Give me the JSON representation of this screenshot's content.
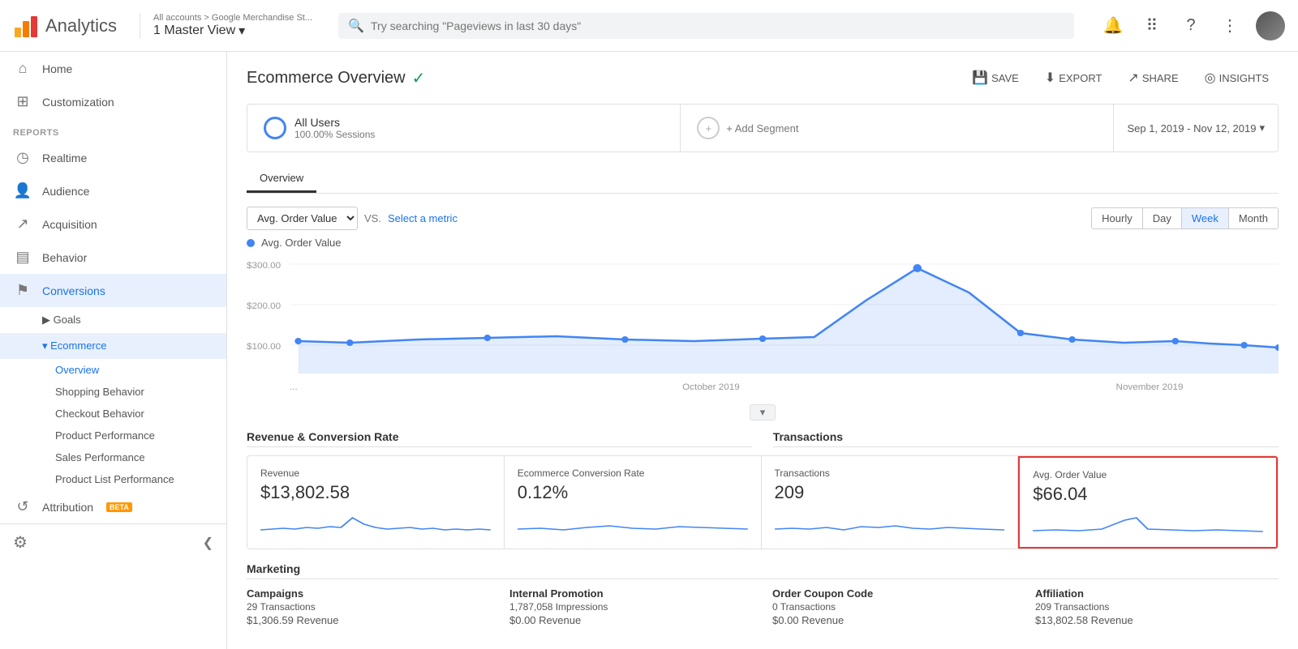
{
  "topbar": {
    "logo_text": "Analytics",
    "account_path": "All accounts > Google Merchandise St...",
    "account_view": "1 Master View",
    "search_placeholder": "Try searching \"Pageviews in last 30 days\"",
    "chevron": "▾"
  },
  "sidebar": {
    "nav_items": [
      {
        "id": "home",
        "icon": "⌂",
        "label": "Home"
      },
      {
        "id": "customization",
        "icon": "⊞",
        "label": "Customization"
      }
    ],
    "reports_label": "REPORTS",
    "report_items": [
      {
        "id": "realtime",
        "icon": "◷",
        "label": "Realtime"
      },
      {
        "id": "audience",
        "icon": "👤",
        "label": "Audience"
      },
      {
        "id": "acquisition",
        "icon": "↗",
        "label": "Acquisition"
      },
      {
        "id": "behavior",
        "icon": "▤",
        "label": "Behavior"
      },
      {
        "id": "conversions",
        "icon": "⚑",
        "label": "Conversions",
        "active": true
      }
    ],
    "conversions_sub": [
      {
        "id": "goals",
        "label": "▶ Goals"
      },
      {
        "id": "ecommerce",
        "label": "▾ Ecommerce",
        "active": true
      }
    ],
    "ecommerce_sub": [
      {
        "id": "overview",
        "label": "Overview",
        "active": true
      },
      {
        "id": "shopping",
        "label": "Shopping Behavior"
      },
      {
        "id": "checkout",
        "label": "Checkout Behavior"
      },
      {
        "id": "product-performance",
        "label": "Product Performance"
      },
      {
        "id": "sales-performance",
        "label": "Sales Performance"
      },
      {
        "id": "product-list",
        "label": "Product List Performance"
      }
    ],
    "attribution": {
      "label": "Attribution",
      "beta": "BETA"
    },
    "footer": {
      "settings_icon": "⚙",
      "collapse_icon": "❮"
    }
  },
  "page": {
    "title": "Ecommerce Overview",
    "verified": true,
    "header_actions": [
      {
        "id": "save",
        "icon": "💾",
        "label": "SAVE"
      },
      {
        "id": "export",
        "icon": "↓",
        "label": "EXPORT"
      },
      {
        "id": "share",
        "icon": "↗",
        "label": "SHARE"
      },
      {
        "id": "insights",
        "icon": "◎",
        "label": "INSIGHTS"
      }
    ]
  },
  "segment": {
    "primary": {
      "label": "All Users",
      "sub": "100.00% Sessions"
    },
    "add_label": "+ Add Segment"
  },
  "date_range": {
    "label": "Sep 1, 2019 - Nov 12, 2019",
    "chevron": "▾"
  },
  "tabs": [
    {
      "id": "overview",
      "label": "Overview",
      "active": true
    }
  ],
  "chart": {
    "metric_label": "Avg. Order Value",
    "vs_text": "VS.",
    "select_metric": "Select a metric",
    "time_buttons": [
      {
        "id": "hourly",
        "label": "Hourly"
      },
      {
        "id": "day",
        "label": "Day"
      },
      {
        "id": "week",
        "label": "Week",
        "active": true
      },
      {
        "id": "month",
        "label": "Month"
      }
    ],
    "legend_label": "Avg. Order Value",
    "y_labels": [
      "$300.00",
      "$200.00",
      "$100.00"
    ],
    "x_labels": [
      "...",
      "October 2019",
      "November 2019"
    ]
  },
  "metrics": {
    "revenue_section": "Revenue & Conversion Rate",
    "transactions_section": "Transactions",
    "cards": [
      {
        "id": "revenue",
        "label": "Revenue",
        "value": "$13,802.58",
        "highlighted": false
      },
      {
        "id": "conversion-rate",
        "label": "Ecommerce Conversion Rate",
        "value": "0.12%",
        "highlighted": false
      },
      {
        "id": "transactions",
        "label": "Transactions",
        "value": "209",
        "highlighted": false
      },
      {
        "id": "avg-order-value",
        "label": "Avg. Order Value",
        "value": "$66.04",
        "highlighted": true
      }
    ]
  },
  "marketing": {
    "title": "Marketing",
    "columns": [
      {
        "id": "campaigns",
        "title": "Campaigns",
        "sub": "29 Transactions",
        "value": "$1,306.59 Revenue"
      },
      {
        "id": "internal-promotion",
        "title": "Internal Promotion",
        "sub": "1,787,058 Impressions",
        "value": "$0.00 Revenue"
      },
      {
        "id": "order-coupon",
        "title": "Order Coupon Code",
        "sub": "0 Transactions",
        "value": "$0.00 Revenue"
      },
      {
        "id": "affiliation",
        "title": "Affiliation",
        "sub": "209 Transactions",
        "value": "$13,802.58 Revenue"
      }
    ]
  }
}
